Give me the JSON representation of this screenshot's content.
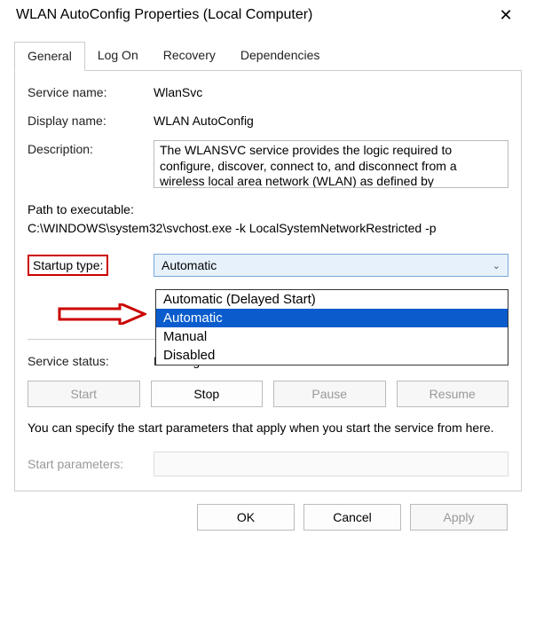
{
  "title": "WLAN AutoConfig Properties (Local Computer)",
  "tabs": {
    "general": "General",
    "logon": "Log On",
    "recovery": "Recovery",
    "dependencies": "Dependencies"
  },
  "labels": {
    "service_name": "Service name:",
    "display_name": "Display name:",
    "description": "Description:",
    "path": "Path to executable:",
    "startup_type": "Startup type:",
    "service_status": "Service status:",
    "start_params": "Start parameters:"
  },
  "values": {
    "service_name": "WlanSvc",
    "display_name": "WLAN AutoConfig",
    "description": "The WLANSVC service provides the logic required to configure, discover, connect to, and disconnect from a wireless local area network (WLAN) as defined by",
    "path": "C:\\WINDOWS\\system32\\svchost.exe -k LocalSystemNetworkRestricted -p",
    "startup_selected": "Automatic",
    "service_status": "Running"
  },
  "dropdown": {
    "opt0": "Automatic (Delayed Start)",
    "opt1": "Automatic",
    "opt2": "Manual",
    "opt3": "Disabled"
  },
  "buttons": {
    "start": "Start",
    "stop": "Stop",
    "pause": "Pause",
    "resume": "Resume",
    "ok": "OK",
    "cancel": "Cancel",
    "apply": "Apply"
  },
  "hint": "You can specify the start parameters that apply when you start the service from here."
}
